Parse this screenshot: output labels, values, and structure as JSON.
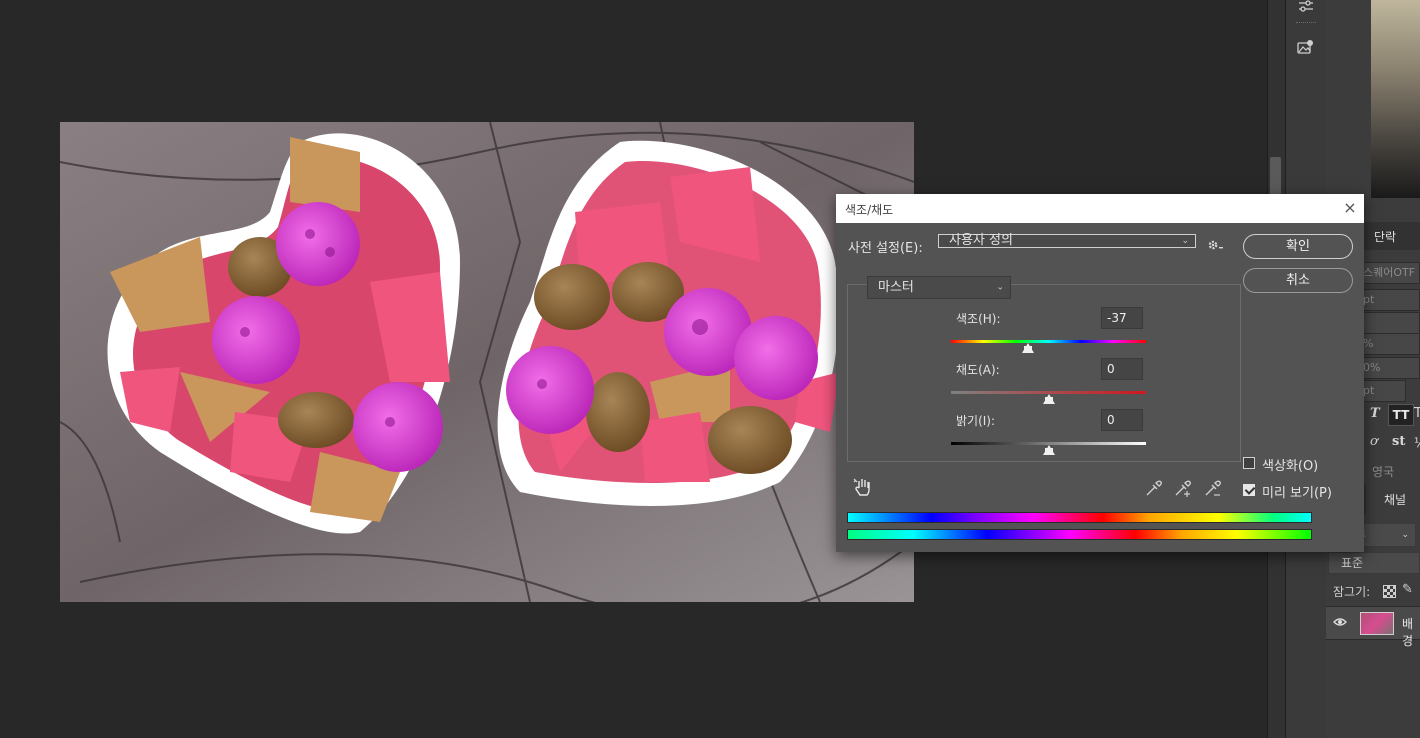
{
  "dialog": {
    "title": "색조/채도",
    "close_icon": "×",
    "preset_label": "사전 설정(E):",
    "preset_value": "사용자 정의",
    "ok_label": "확인",
    "cancel_label": "취소",
    "channel_value": "마스터",
    "hue": {
      "label": "색조(H):",
      "value": "-37",
      "level": -37,
      "min": -180,
      "max": 180
    },
    "saturation": {
      "label": "채도(A):",
      "value": "0",
      "level": 0,
      "min": -100,
      "max": 100
    },
    "lightness": {
      "label": "밝기(I):",
      "value": "0",
      "level": 0,
      "min": -100,
      "max": 100
    },
    "colorize_label": "색상화(O)",
    "colorize_checked": false,
    "preview_label": "미리 보기(P)",
    "preview_checked": true
  },
  "right_panel": {
    "tab_paragraph": "단락",
    "font_name": "스퀘어OTF",
    "field_pt1": "pt",
    "field_pct": "%",
    "field_pct2": "0%",
    "field_pt2": "pt",
    "language": "영국",
    "tab_channels": "채널",
    "kind_field": "류",
    "blend_mode": "표준",
    "lock_label": "잠그기:",
    "layer_name": "배경"
  },
  "icons": {
    "adjust": "sliders-icon",
    "libraries": "image-library-icon",
    "settings": "gear-icon",
    "hand": "hand-icon",
    "eyedropper": "eyedropper-icon",
    "eyedropper_plus": "eyedropper-plus-icon",
    "eyedropper_minus": "eyedropper-minus-icon",
    "visibility": "eye-icon"
  }
}
